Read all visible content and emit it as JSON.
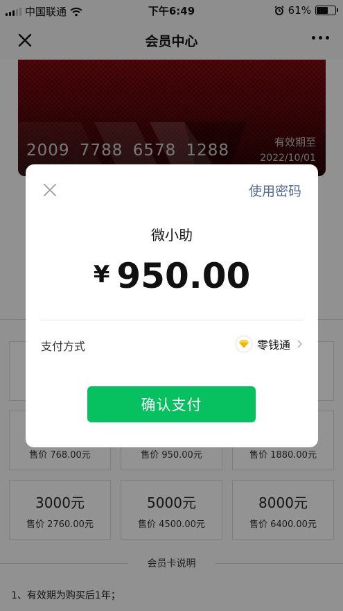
{
  "status_bar": {
    "carrier": "中国联通",
    "time": "下午6:49",
    "battery": "61%",
    "battery_level": 0.61
  },
  "nav": {
    "title": "会员中心"
  },
  "card": {
    "number": "2009 7788 6578 1288",
    "valid_label": "有效期至",
    "valid_date": "2022/10/01"
  },
  "tiles": [
    {
      "amount": "",
      "price": ""
    },
    {
      "amount": "",
      "price": ""
    },
    {
      "amount": "",
      "price": ""
    },
    {
      "amount": "",
      "price": "售价 768.00元"
    },
    {
      "amount": "",
      "price": "售价 950.00元"
    },
    {
      "amount": "",
      "price": "售价 1880.00元"
    },
    {
      "amount": "3000元",
      "price": "售价 2760.00元"
    },
    {
      "amount": "5000元",
      "price": "售价 4500.00元"
    },
    {
      "amount": "8000元",
      "price": "售价 6400.00元"
    }
  ],
  "notes": {
    "title": "会员卡说明",
    "items": [
      "1、有效期为购买后1年；"
    ]
  },
  "payment_modal": {
    "use_password": "使用密码",
    "merchant": "微小助",
    "currency": "¥",
    "amount": "950.00",
    "method_label": "支付方式",
    "method_value": "零钱通",
    "confirm_button": "确认支付"
  },
  "colors": {
    "wechat_green": "#07c160",
    "link_blue": "#576b95",
    "card_red": "#8a0d12"
  },
  "icons": [
    "signal-icon",
    "wifi-icon",
    "alarm-icon",
    "battery-icon",
    "close-icon",
    "more-icon",
    "diamond-icon",
    "chevron-right-icon"
  ]
}
